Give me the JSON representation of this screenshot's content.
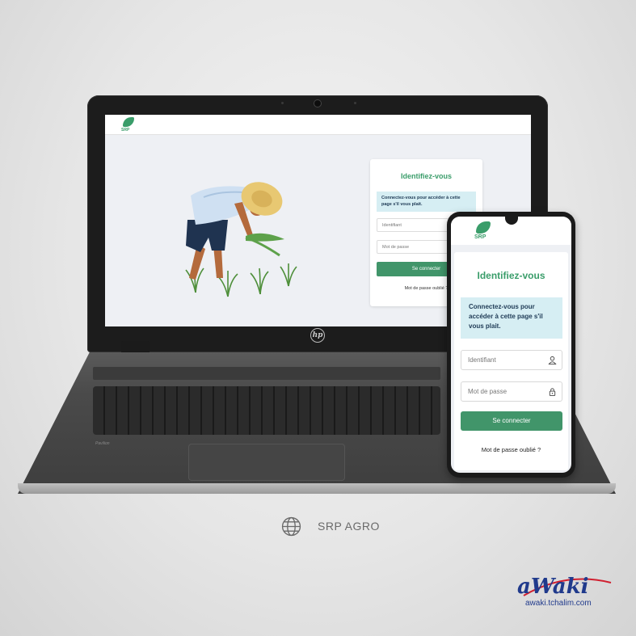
{
  "laptop_screen": {
    "brand_logo_text": "SRP",
    "login_card": {
      "title": "Identifiez-vous",
      "info_text": "Connectez-vous pour accéder à cette page s'il vous plait.",
      "username_placeholder": "Identifiant",
      "password_placeholder": "Mot de passe",
      "submit_label": "Se connecter",
      "forgot_link": "Mot de passe oublié ?"
    }
  },
  "laptop_brand": "Pavilion",
  "phone_screen": {
    "brand_logo_text": "SRP",
    "login_card": {
      "title": "Identifiez-vous",
      "info_text": "Connectez-vous pour accéder à cette page s'il vous plait.",
      "username_placeholder": "Identifiant",
      "password_placeholder": "Mot de passe",
      "submit_label": "Se connecter",
      "forgot_link": "Mot de passe oublié ?"
    }
  },
  "caption": {
    "icon": "globe-icon",
    "text": "SRP AGRO"
  },
  "watermark": {
    "logo": "aWaki",
    "url": "awaki.tchalim.com"
  },
  "colors": {
    "brand_green": "#41956a",
    "title_green": "#3a9d6a",
    "info_bg": "#d6eef3",
    "page_bg": "#eef0f4"
  }
}
